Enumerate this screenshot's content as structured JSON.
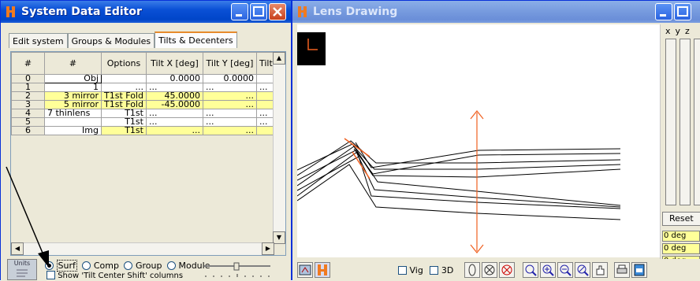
{
  "left_window": {
    "title": "System Data Editor",
    "tabs": [
      "Edit system",
      "Groups & Modules",
      "Tilts & Decenters"
    ],
    "active_tab": 2,
    "table": {
      "headers": [
        "#",
        "#",
        "Options",
        "Tilt X [deg]",
        "Tilt Y [deg]",
        "Tilt Z"
      ],
      "rows": [
        {
          "n": "0",
          "name": "Obj",
          "options": "",
          "tx": "0.0000",
          "ty": "0.0000",
          "tz": ""
        },
        {
          "n": "1",
          "name": "1",
          "options": "...",
          "tx": "...",
          "ty": "...",
          "tz": "..."
        },
        {
          "n": "2",
          "name": "3 mirror",
          "options": "T1st Fold",
          "tx": "45.0000",
          "ty": "...",
          "tz": ""
        },
        {
          "n": "3",
          "name": "5 mirror",
          "options": "T1st Fold",
          "tx": "-45.0000",
          "ty": "...",
          "tz": ""
        },
        {
          "n": "4",
          "name": "7 thinlens",
          "options": "T1st",
          "tx": "...",
          "ty": "...",
          "tz": "..."
        },
        {
          "n": "5",
          "name": "",
          "options": "T1st",
          "tx": "...",
          "ty": "...",
          "tz": "..."
        },
        {
          "n": "6",
          "name": "Img",
          "options": "T1st",
          "tx": "...",
          "ty": "...",
          "tz": ""
        }
      ]
    },
    "units_label": "Units",
    "radio_options": [
      "Surf",
      "Comp",
      "Group",
      "Module"
    ],
    "selected_radio": "Surf",
    "checkbox_label": "Show 'Tilt Center Shift' columns"
  },
  "right_window": {
    "title": "Lens Drawing",
    "vig_label": "Vig",
    "threed_label": "3D",
    "side": {
      "axis_labels": [
        "x",
        "y",
        "z"
      ],
      "reset_label": "Reset",
      "deg_values": [
        "0 deg",
        "0 deg",
        "0 deg"
      ]
    }
  },
  "colors": {
    "titlebar": "#0a50d6",
    "highlight_row": "#ffff99",
    "lens_orange": "#f06020"
  }
}
